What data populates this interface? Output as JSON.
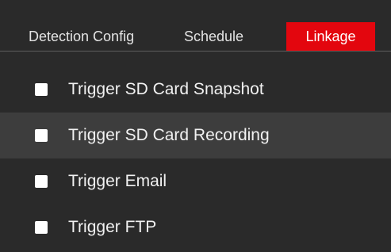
{
  "tabs": [
    {
      "label": "Detection Config",
      "active": false
    },
    {
      "label": "Schedule",
      "active": false
    },
    {
      "label": "Linkage",
      "active": true
    }
  ],
  "colors": {
    "background": "#2a2a2a",
    "active_tab": "#e3060e",
    "hover_row": "#3d3d3d",
    "checkbox": "#ffffff"
  },
  "linkage_options": [
    {
      "label": "Trigger SD Card Snapshot",
      "checked": false
    },
    {
      "label": "Trigger SD Card Recording",
      "checked": false
    },
    {
      "label": "Trigger Email",
      "checked": false
    },
    {
      "label": "Trigger FTP",
      "checked": false
    }
  ]
}
